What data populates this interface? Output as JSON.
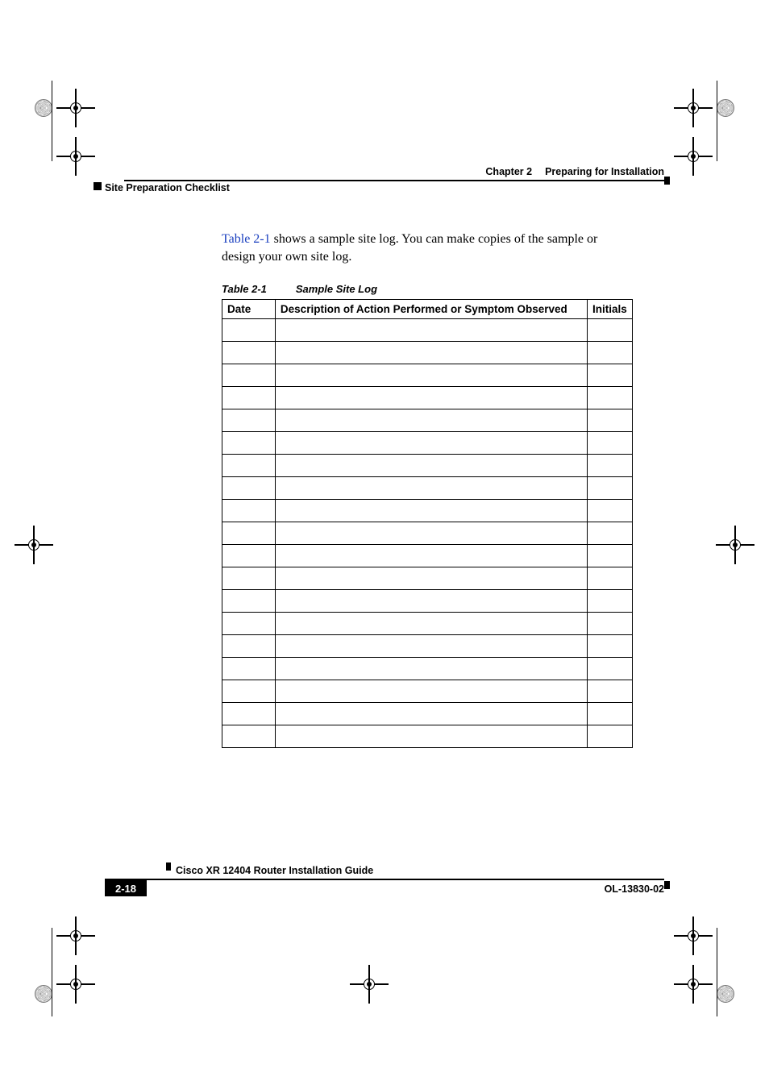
{
  "header": {
    "chapter_label": "Chapter 2",
    "chapter_title": "Preparing for Installation",
    "section_title": "Site Preparation Checklist"
  },
  "body": {
    "xref": "Table 2-1",
    "para_rest": " shows a sample site log. You can make copies of the sample or design your own site log."
  },
  "table": {
    "caption_num": "Table 2-1",
    "caption_title": "Sample Site Log",
    "columns": {
      "date": "Date",
      "description": "Description of Action Performed or Symptom Observed",
      "initials": "Initials"
    },
    "row_count": 19
  },
  "footer": {
    "guide_title": "Cisco XR 12404 Router Installation Guide",
    "page_number": "2-18",
    "doc_number": "OL-13830-02"
  }
}
